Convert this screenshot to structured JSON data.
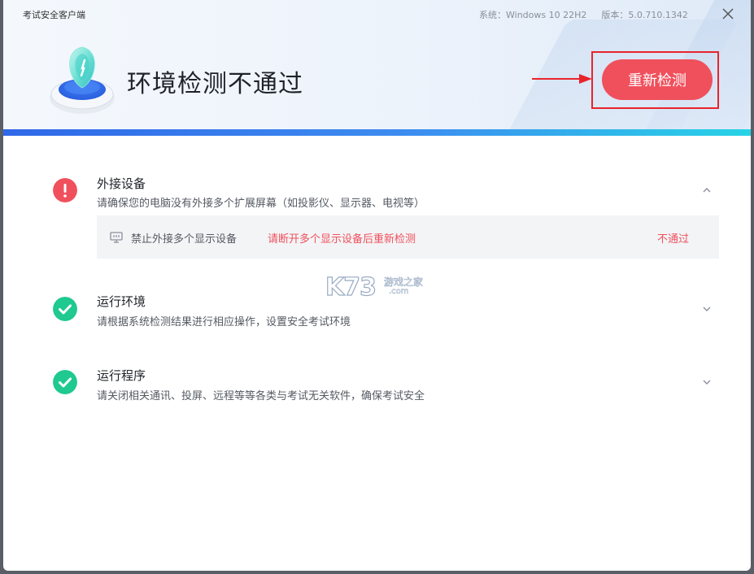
{
  "window": {
    "app_title": "考试安全客户端",
    "system_label": "系统：Windows 10 22H2",
    "version_label": "版本：5.0.710.1342"
  },
  "status": {
    "title": "环境检测不通过",
    "retest_label": "重新检测"
  },
  "sections": [
    {
      "title": "外接设备",
      "description": "请确保您的电脑没有外接多个扩展屏幕（如投影仪、显示器、电视等）",
      "state": "fail",
      "expanded": true,
      "details": [
        {
          "icon": "monitor-icon",
          "label": "禁止外接多个显示设备",
          "message": "请断开多个显示设备后重新检测",
          "result": "不通过"
        }
      ]
    },
    {
      "title": "运行环境",
      "description": "请根据系统检测结果进行相应操作，设置安全考试环境",
      "state": "pass",
      "expanded": false
    },
    {
      "title": "运行程序",
      "description": "请关闭相关通讯、投屏、远程等等各类与考试无关软件，确保考试安全",
      "state": "pass",
      "expanded": false
    }
  ],
  "watermark": {
    "logo_text": "K73",
    "site_name": "游戏之家",
    "domain": ".com"
  },
  "colors": {
    "fail": "#f0505c",
    "pass": "#1fc98f",
    "accent_start": "#2f68e8",
    "accent_end": "#27d3e6",
    "annotation_red": "#e8232a"
  }
}
